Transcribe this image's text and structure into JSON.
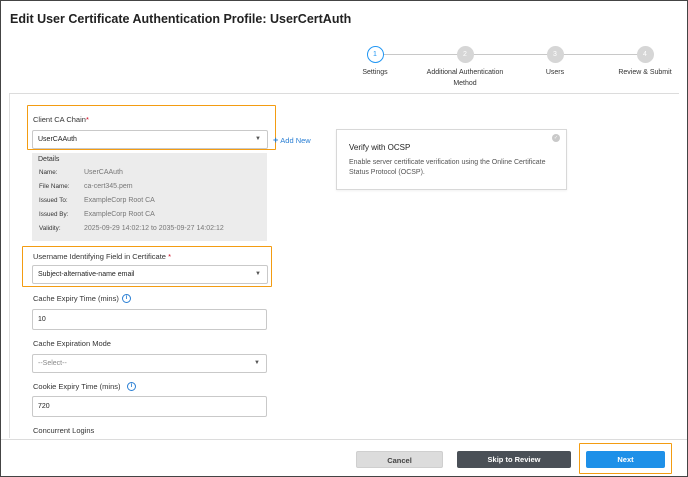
{
  "title": "Edit User Certificate Authentication Profile: UserCertAuth",
  "stepper": {
    "steps": [
      {
        "num": "1",
        "label": "Settings"
      },
      {
        "num": "2",
        "label": "Additional Authentication Method"
      },
      {
        "num": "3",
        "label": "Users"
      },
      {
        "num": "4",
        "label": "Review & Submit"
      }
    ],
    "active_step": 1
  },
  "form": {
    "client_ca": {
      "label": "Client CA Chain",
      "required": "*",
      "value": "UserCAAuth"
    },
    "add_new": "Add New",
    "details": {
      "title": "Details",
      "rows": [
        {
          "key": "Name:",
          "value": "UserCAAuth"
        },
        {
          "key": "File Name:",
          "value": "ca-cert345.pem"
        },
        {
          "key": "Issued To:",
          "value": "ExampleCorp Root CA"
        },
        {
          "key": "Issued By:",
          "value": "ExampleCorp Root CA"
        },
        {
          "key": "Validity:",
          "value": "2025-09-29 14:02:12 to 2035-09-27 14:02:12"
        }
      ]
    },
    "username_field": {
      "label": "Username Identifying Field in Certificate",
      "required": "*",
      "value": "Subject-alternative-name email"
    },
    "cache_expiry": {
      "label": "Cache Expiry Time (mins)",
      "value": "10"
    },
    "cache_mode": {
      "label": "Cache Expiration Mode",
      "value": "--Select--"
    },
    "cookie_expiry": {
      "label": "Cookie Expiry Time (mins)",
      "value": "720"
    },
    "concurrent_logins": {
      "label": "Concurrent Logins"
    }
  },
  "ocsp": {
    "title": "Verify with OCSP",
    "description": "Enable server certificate verification using the Online Certificate Status Protocol (OCSP)."
  },
  "footer": {
    "cancel": "Cancel",
    "skip": "Skip to Review",
    "next": "Next"
  },
  "colors": {
    "accent": "#2196f3",
    "highlight": "#f39c12",
    "next_button": "#1e90e8",
    "skip_button": "#4a5057"
  }
}
